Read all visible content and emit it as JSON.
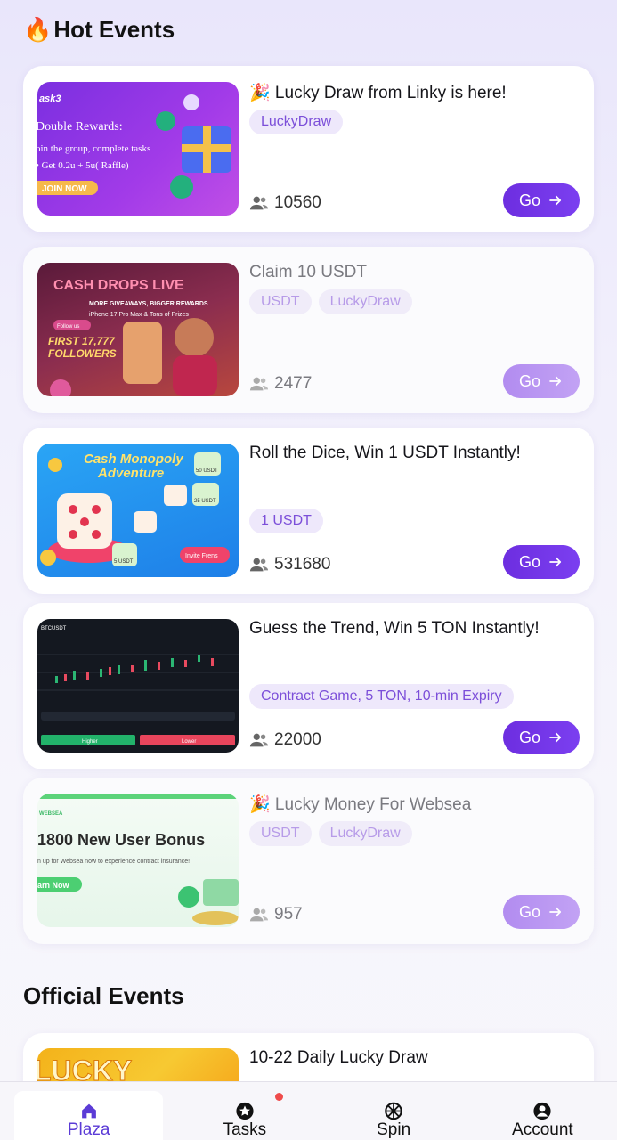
{
  "hot_events_title": "Hot Events",
  "hot_events_icon": "fire-emoji",
  "official_events_title": "Official Events",
  "go_label": "Go",
  "events": [
    {
      "title": "🎉 Lucky Draw from Linky is here!",
      "tags": [
        "LuckyDraw"
      ],
      "participants": "10560"
    },
    {
      "title": "Claim 10 USDT",
      "tags": [
        "USDT",
        "LuckyDraw"
      ],
      "participants": "2477"
    },
    {
      "title": "Roll the Dice, Win 1 USDT Instantly!",
      "tags": [
        "1 USDT"
      ],
      "participants": "531680"
    },
    {
      "title": "Guess the Trend, Win 5 TON Instantly!",
      "tags": [
        "Contract Game, 5 TON, 10-min Expiry"
      ],
      "participants": "22000"
    },
    {
      "title": "🎉 Lucky Money For Websea",
      "tags": [
        "USDT",
        "LuckyDraw"
      ],
      "participants": "957"
    }
  ],
  "official_event": {
    "title": "10-22 Daily Lucky Draw"
  },
  "thumb_texts": {
    "e1": {
      "brand": "ask3",
      "headline": "Double Rewards:",
      "line1": "oin the group, complete tasks",
      "line2": "• Get 0.2u + 5u( Raffle)",
      "cta": "JOIN NOW"
    },
    "e2": {
      "headline": "CASH DROPS LIVE",
      "line1": "MORE GIVEAWAYS, BIGGER REWARDS",
      "line2": "iPhone 17 Pro Max & Tons of Prizes",
      "line3": "FIRST 17,777",
      "line4": "FOLLOWERS",
      "follow": "Follow us"
    },
    "e3": {
      "headline": "Cash Monopoly",
      "headline2": "Adventure",
      "p1": "50 USDT",
      "p2": "25 USDT",
      "p3": "5 USDT",
      "invite": "Invite Frens"
    },
    "e4": {
      "pair": "BTCUSDT",
      "higher": "Higher",
      "lower": "Lower"
    },
    "e5": {
      "brand": "WEBSEA",
      "headline": "1800 New User Bonus",
      "line1": "n up for Websea now to experience contract insurance!",
      "cta": "arn Now"
    },
    "e6": {
      "headline": "LUCKY"
    }
  },
  "nav": [
    {
      "label": "Plaza",
      "icon": "home-icon",
      "active": true
    },
    {
      "label": "Tasks",
      "icon": "star-icon",
      "badge": true
    },
    {
      "label": "Spin",
      "icon": "wheel-icon"
    },
    {
      "label": "Account",
      "icon": "account-icon"
    }
  ],
  "colors": {
    "accent": "#6d2ee0",
    "tag_bg": "#eee8fb",
    "tag_text": "#7c4fd9"
  }
}
